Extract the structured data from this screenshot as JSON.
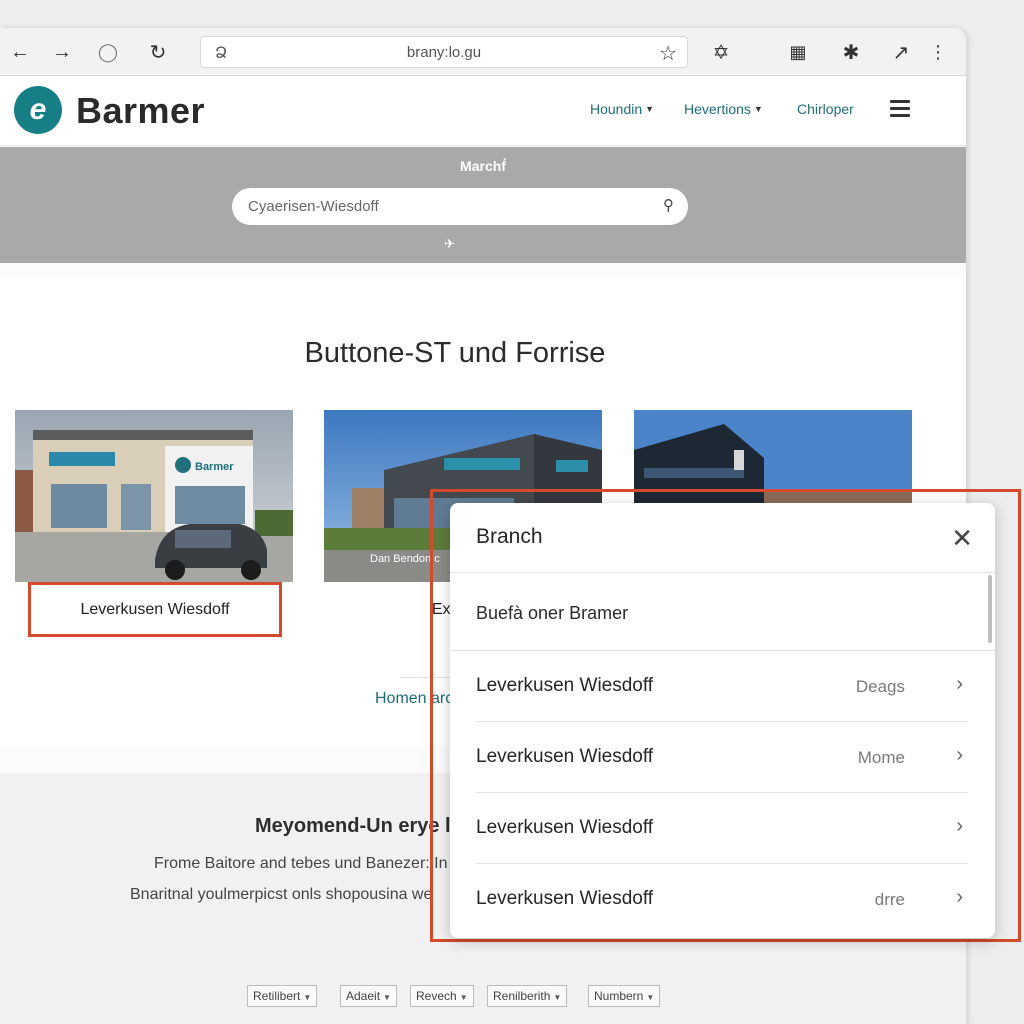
{
  "browser": {
    "url": "brany:lo.gu",
    "icons": [
      "back-icon",
      "forward-icon",
      "home-icon",
      "reload-icon",
      "lock-icon",
      "bookmark-star-icon",
      "extension-icon",
      "qr-icon",
      "star-icon",
      "share-icon",
      "menu-dots-icon"
    ]
  },
  "header": {
    "logo_text": "Barmer",
    "nav": [
      {
        "label": "Houndin"
      },
      {
        "label": "Hevertions"
      },
      {
        "label": "Chirloper"
      }
    ]
  },
  "search": {
    "band_title": "Marchf́",
    "value": "Cyaerisen-Wiesdoff"
  },
  "main": {
    "title": "Buttone-ST und Forrise",
    "cards": [
      {
        "label": "Leverkusen Wiesdoff",
        "sign": "Barmer"
      },
      {
        "label": "Exand G",
        "sign": "Dan Bendon c"
      },
      {
        "label": "",
        "sign": ""
      }
    ],
    "more_link": "Homen arc"
  },
  "footer": {
    "title": "Meyomend-Un erye l",
    "line1": "Frome Baitore and tebes und Banezer: In",
    "line2": "Bnaritnal youlmerpicst onls shopousina we",
    "selects": [
      "Retilibert",
      "Adaeit",
      "Revech",
      "Renilberith",
      "Numbern"
    ]
  },
  "panel": {
    "title": "Branch",
    "subtitle": "Buefà oner Bramer",
    "rows": [
      {
        "name": "Leverkusen Wiesdoff",
        "meta": "Deags"
      },
      {
        "name": "Leverkusen Wiesdoff",
        "meta": "Mome"
      },
      {
        "name": "Leverkusen Wiesdoff",
        "meta": ""
      },
      {
        "name": "Leverkusen Wiesdoff",
        "meta": "drre"
      }
    ]
  },
  "colors": {
    "brand_teal": "#167f86",
    "highlight_red": "#d34a2c",
    "nav_link": "#1e6d7c",
    "search_band": "#a9a9a9"
  }
}
